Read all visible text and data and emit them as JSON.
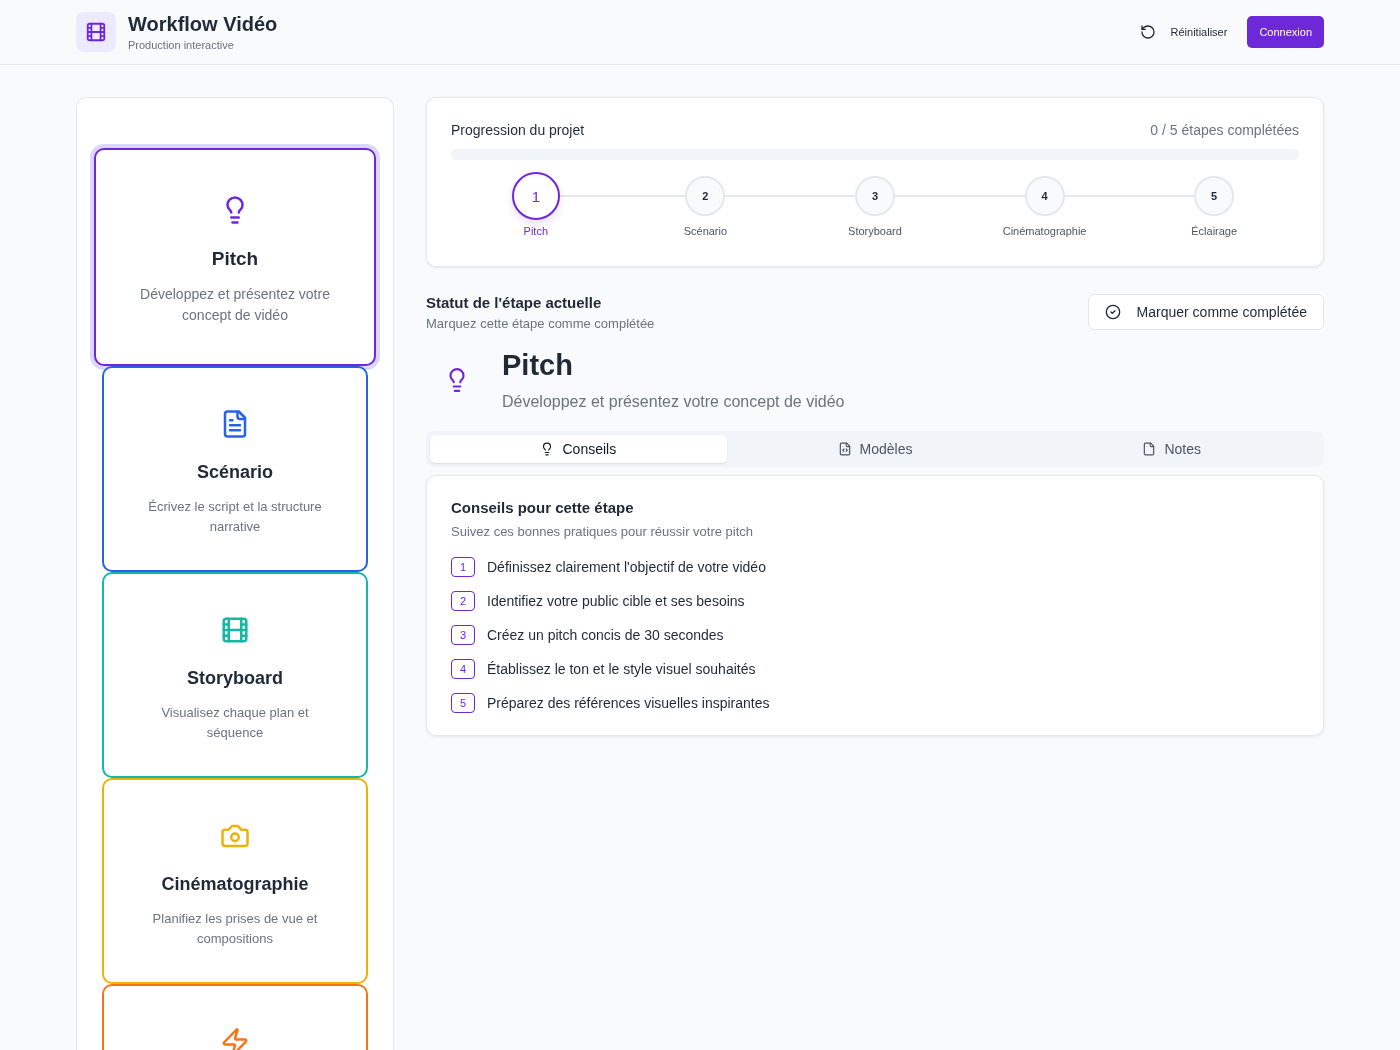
{
  "header": {
    "app_title": "Workflow Vidéo",
    "app_subtitle": "Production interactive",
    "reset_label": "Réinitialiser",
    "login_label": "Connexion"
  },
  "sidebar": {
    "cards": [
      {
        "kind": "bulb",
        "color": "#6d28d9",
        "title": "Pitch",
        "description": "Développez et présentez votre concept de vidéo",
        "selected": true
      },
      {
        "kind": "document",
        "color": "#2563eb",
        "title": "Scénario",
        "description": "Écrivez le script et la structure narrative",
        "selected": false
      },
      {
        "kind": "film",
        "color": "#14b8a6",
        "title": "Storyboard",
        "description": "Visualisez chaque plan et séquence",
        "selected": false
      },
      {
        "kind": "camera",
        "color": "#eab308",
        "title": "Cinématographie",
        "description": "Planifiez les prises de vue et compositions",
        "selected": false
      },
      {
        "kind": "bolt",
        "color": "#f97316",
        "selected": false
      }
    ]
  },
  "progress": {
    "title": "Progression du projet",
    "count": "0 / 5 étapes complétées",
    "level": 0,
    "steps": [
      {
        "number": "1",
        "label": "Pitch",
        "selected": true
      },
      {
        "number": "2",
        "label": "Scénario",
        "selected": false
      },
      {
        "number": "3",
        "label": "Storyboard",
        "selected": false
      },
      {
        "number": "4",
        "label": "Cinématographie",
        "selected": false
      },
      {
        "number": "5",
        "label": "Éclairage",
        "selected": false
      }
    ]
  },
  "status": {
    "title": "Statut de l'étape actuelle",
    "subtitle": "Marquez cette étape comme complétée",
    "button": "Marquer comme complétée"
  },
  "current_step": {
    "kind": "bulb",
    "title": "Pitch",
    "description": "Développez et présentez votre concept de vidéo"
  },
  "tabs": [
    {
      "kind": "bulb",
      "label": "Conseils",
      "selected": true
    },
    {
      "kind": "file-code",
      "label": "Modèles",
      "selected": false
    },
    {
      "kind": "file",
      "label": "Notes",
      "selected": false
    }
  ],
  "tips": {
    "title": "Conseils pour cette étape",
    "subtitle": "Suivez ces bonnes pratiques pour réussir votre pitch",
    "items": [
      {
        "number": "1",
        "text": "Définissez clairement l'objectif de votre vidéo"
      },
      {
        "number": "2",
        "text": "Identifiez votre public cible et ses besoins"
      },
      {
        "number": "3",
        "text": "Créez un pitch concis de 30 secondes"
      },
      {
        "number": "4",
        "text": "Établissez le ton et le style visuel souhaités"
      },
      {
        "number": "5",
        "text": "Préparez des références visuelles inspirantes"
      }
    ]
  }
}
